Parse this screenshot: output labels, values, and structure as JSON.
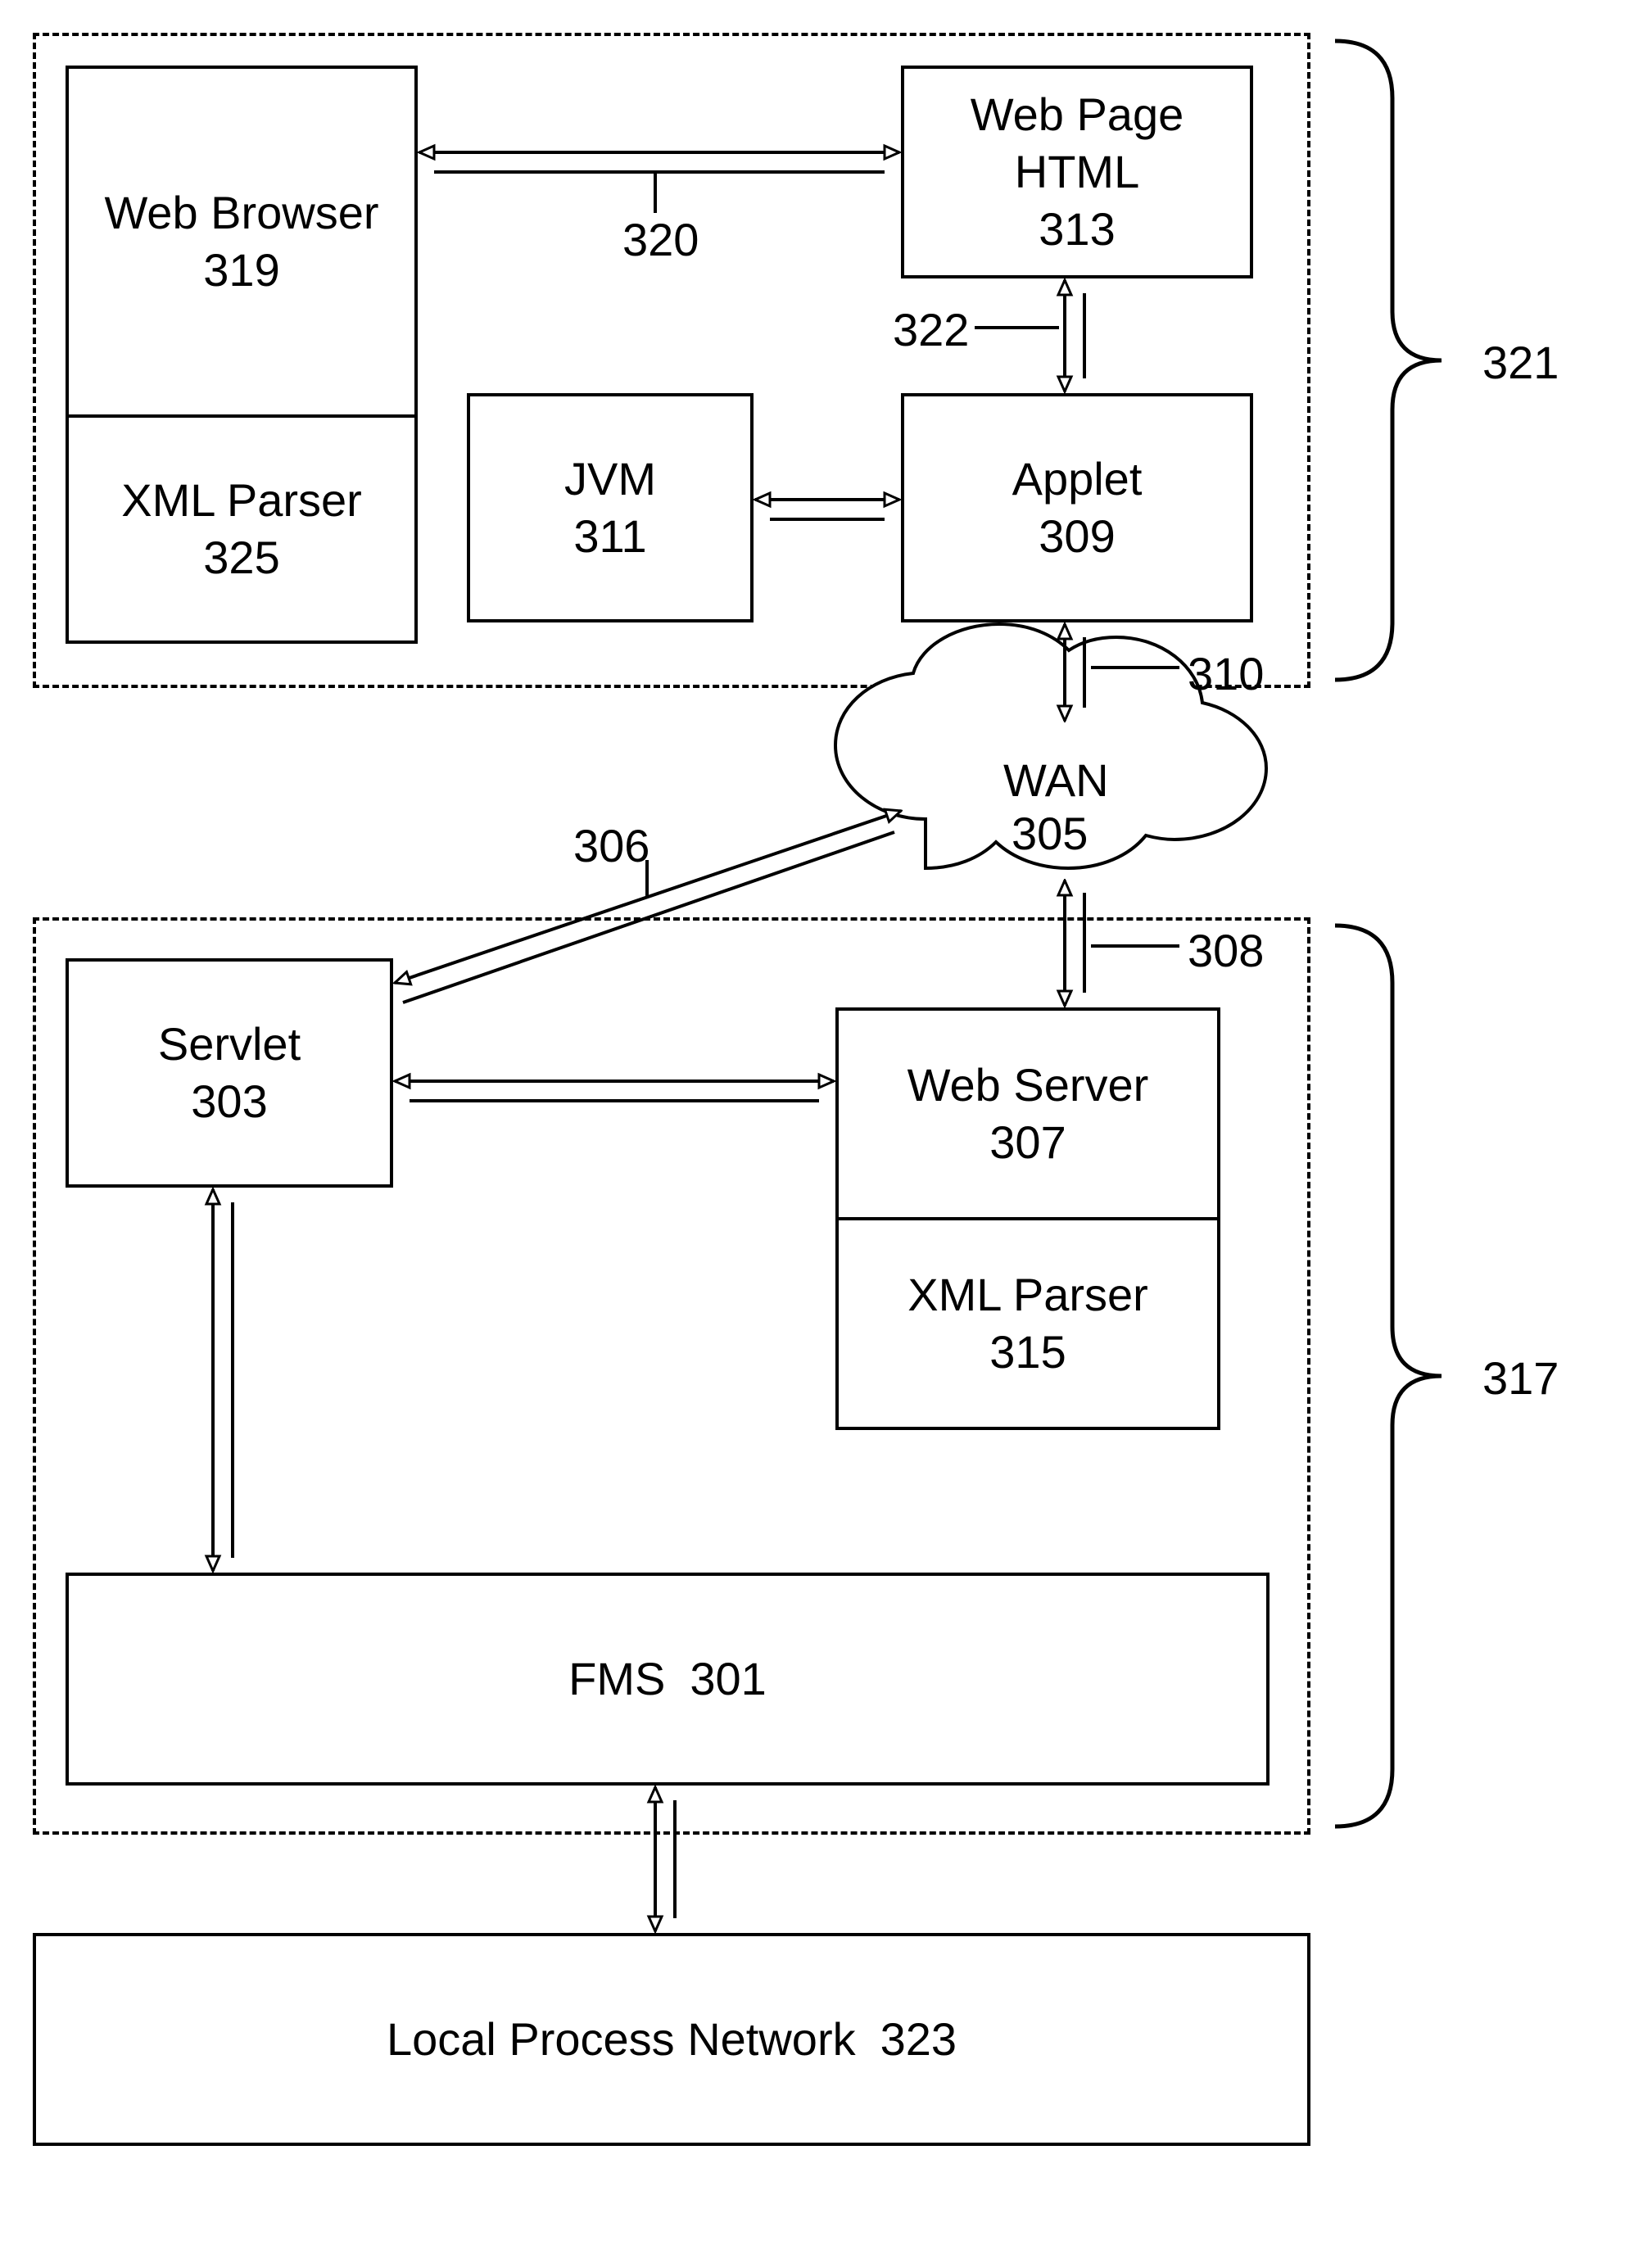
{
  "client": {
    "id": "321",
    "web_browser": {
      "title": "Web Browser",
      "id": "319"
    },
    "xml_parser": {
      "title": "XML Parser",
      "id": "325"
    },
    "jvm": {
      "title": "JVM",
      "id": "311"
    },
    "web_page_html": {
      "title": "Web Page HTML",
      "id": "313"
    },
    "applet": {
      "title": "Applet",
      "id": "309"
    }
  },
  "wan": {
    "title": "WAN",
    "id": "305"
  },
  "server": {
    "id": "317",
    "servlet": {
      "title": "Servlet",
      "id": "303"
    },
    "web_server": {
      "title": "Web Server",
      "id": "307"
    },
    "xml_parser": {
      "title": "XML Parser",
      "id": "315"
    },
    "fms": {
      "title": "FMS",
      "id": "301"
    }
  },
  "local_process_network": {
    "title": "Local Process Network",
    "id": "323"
  },
  "connections": {
    "browser_to_webpage": {
      "id": "320"
    },
    "webpage_to_applet": {
      "id": "322"
    },
    "applet_to_wan": {
      "id": "310"
    },
    "servlet_to_wan": {
      "id": "306"
    },
    "webserver_to_wan": {
      "id": "308"
    }
  }
}
